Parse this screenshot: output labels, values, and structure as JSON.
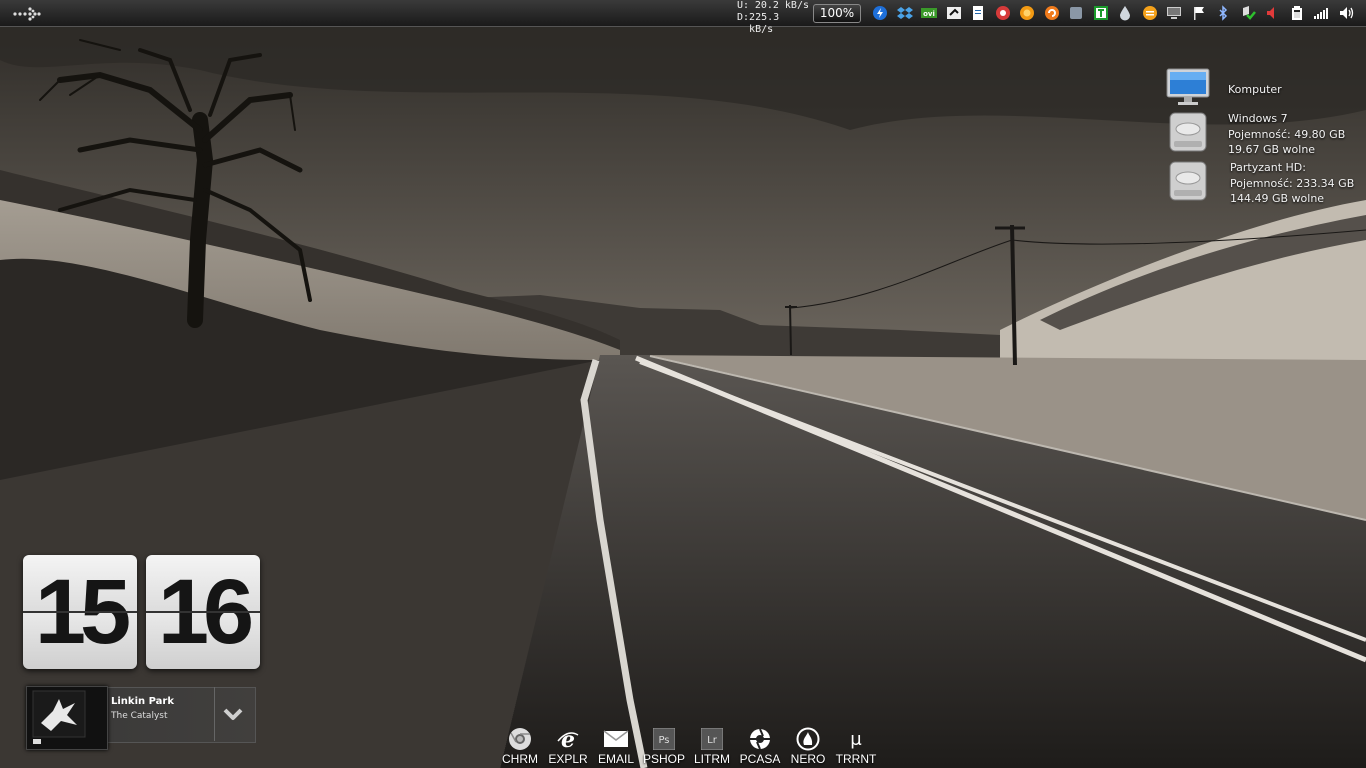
{
  "net": {
    "up_label": "U:",
    "up_value": "20.2 kB/s",
    "down_label": "D:",
    "down_value": "225.3 kB/s"
  },
  "zoom": "100%",
  "tray_icons": [
    "flashget-icon",
    "dropbox-icon",
    "ovi-icon",
    "logitech-icon",
    "document-icon",
    "red-app-icon",
    "orange-app-icon",
    "orange-sync-icon",
    "grey-app-icon",
    "green-t-icon",
    "drop-icon",
    "orange-bar-icon",
    "monitor-icon",
    "flag-icon",
    "bluetooth-icon",
    "shield-check-icon",
    "red-speaker-icon",
    "battery-icon",
    "signal-icon",
    "volume-icon"
  ],
  "drives": [
    {
      "icon": "monitor-icon",
      "lines": [
        "",
        "Komputer"
      ]
    },
    {
      "icon": "hard-drive-icon",
      "lines": [
        "Windows 7",
        "Pojemność: 49.80 GB",
        "19.67 GB wolne"
      ]
    },
    {
      "icon": "hard-drive-icon",
      "lines": [
        "Partyzant HD:",
        "Pojemność: 233.34 GB",
        "144.49 GB wolne"
      ]
    }
  ],
  "clock": {
    "hours": "15",
    "minutes": "16"
  },
  "music": {
    "artist": "Linkin Park",
    "track": "The Catalyst"
  },
  "dock": [
    {
      "label": "CHRM",
      "icon": "chrome-icon"
    },
    {
      "label": "EXPLR",
      "icon": "internet-explorer-icon"
    },
    {
      "label": "EMAIL",
      "icon": "email-icon"
    },
    {
      "label": "PSHOP",
      "icon": "photoshop-icon"
    },
    {
      "label": "LITRM",
      "icon": "lightroom-icon"
    },
    {
      "label": "PCASA",
      "icon": "picasa-icon"
    },
    {
      "label": "NERO",
      "icon": "nero-icon"
    },
    {
      "label": "TRRNT",
      "icon": "utorrent-icon"
    }
  ]
}
